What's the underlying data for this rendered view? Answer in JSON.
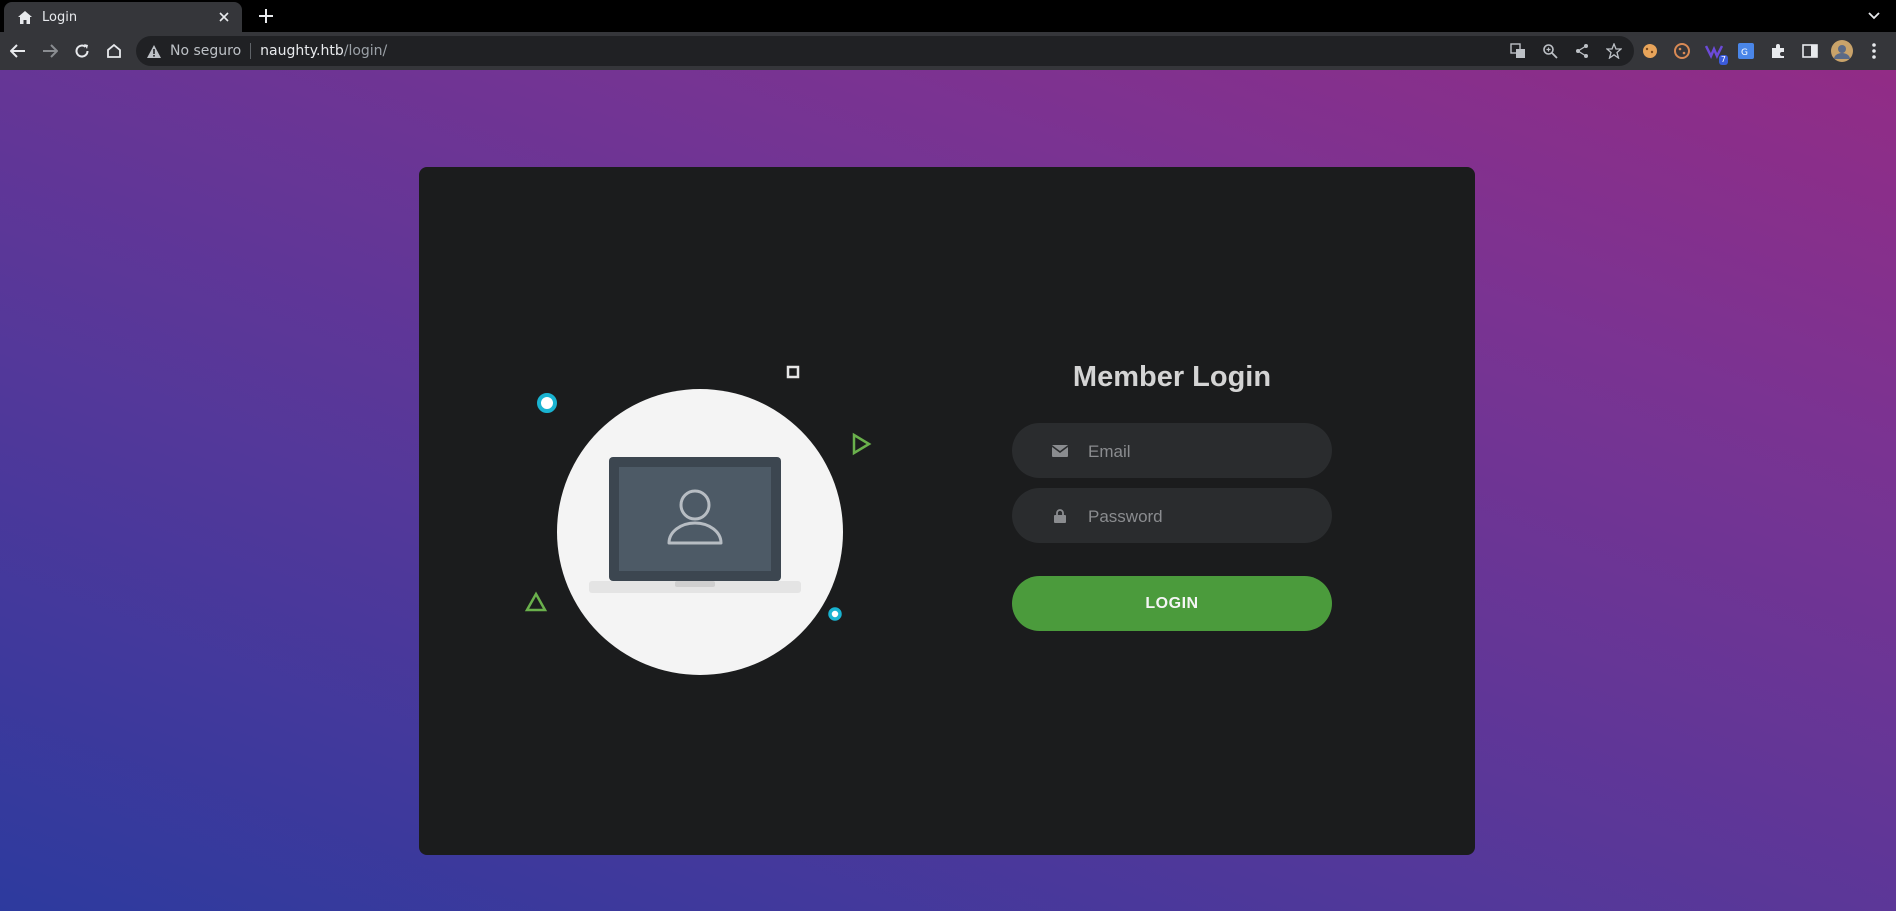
{
  "browser": {
    "tab": {
      "title": "Login",
      "favicon": "home-icon"
    },
    "security_text": "No seguro",
    "url_host": "naughty.htb",
    "url_path": "/login/",
    "extension_badge": "7"
  },
  "login": {
    "title": "Member Login",
    "email_placeholder": "Email",
    "password_placeholder": "Password",
    "button_label": "LOGIN"
  },
  "colors": {
    "card": "#1b1c1d",
    "accent_green": "#4b9b3c",
    "decor_cyan": "#19b3d1",
    "decor_green": "#6ab04c"
  }
}
